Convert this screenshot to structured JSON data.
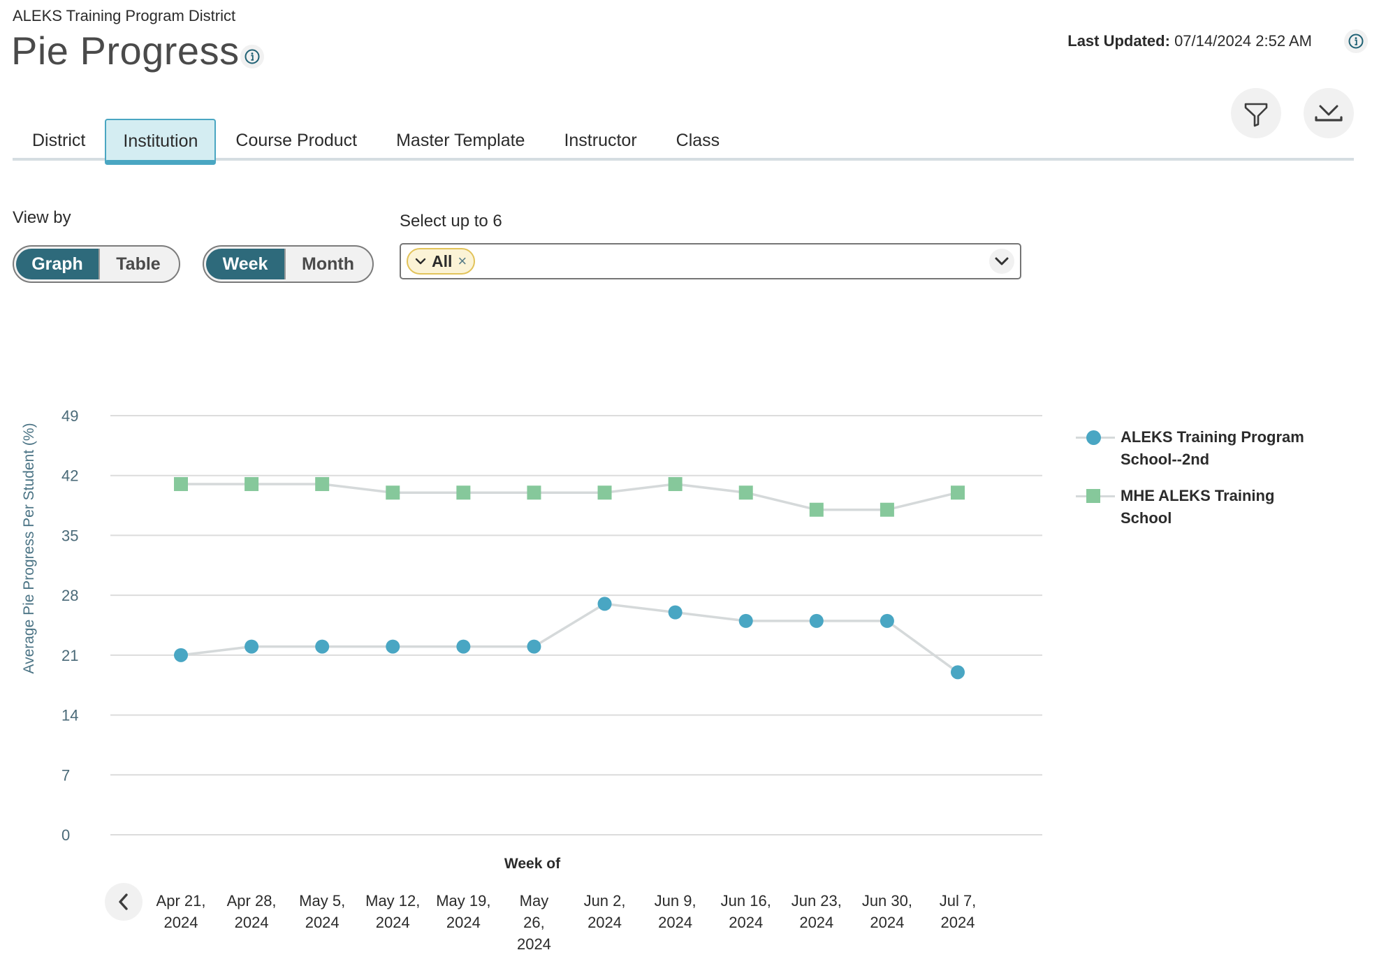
{
  "header": {
    "breadcrumb": "ALEKS Training Program District",
    "title": "Pie Progress",
    "title_info_icon": "info-icon",
    "last_updated_label": "Last Updated:",
    "last_updated_value": "07/14/2024 2:52 AM",
    "last_updated_info_icon": "info-icon",
    "filter_icon": "filter-icon",
    "download_icon": "download-icon"
  },
  "tabs": [
    {
      "label": "District",
      "active": false
    },
    {
      "label": "Institution",
      "active": true
    },
    {
      "label": "Course Product",
      "active": false
    },
    {
      "label": "Master Template",
      "active": false
    },
    {
      "label": "Instructor",
      "active": false
    },
    {
      "label": "Class",
      "active": false
    }
  ],
  "controls": {
    "view_by_label": "View by",
    "view_options": [
      {
        "label": "Graph",
        "selected": true
      },
      {
        "label": "Table",
        "selected": false
      }
    ],
    "period_options": [
      {
        "label": "Week",
        "selected": true
      },
      {
        "label": "Month",
        "selected": false
      }
    ],
    "select_label": "Select up to 6",
    "selected_chip": "All",
    "chip_remove": "×"
  },
  "colors": {
    "accent_teal": "#2e6a7b",
    "tab_active_bg": "#d4edf2",
    "tab_active_border": "#4aa6c2",
    "series_blue": "#49a6c3",
    "series_green": "#86c89b",
    "chip_bg": "#fbf3d6",
    "chip_border": "#e2c35a"
  },
  "chart_data": {
    "type": "line",
    "title": "",
    "xlabel": "Week of",
    "ylabel": "Average Pie Progress Per Student (%)",
    "ylim": [
      0,
      49
    ],
    "yticks": [
      0,
      7,
      14,
      21,
      28,
      35,
      42,
      49
    ],
    "grid": true,
    "legend_position": "right",
    "categories": [
      [
        "Apr 21,",
        "2024"
      ],
      [
        "Apr 28,",
        "2024"
      ],
      [
        "May 5,",
        "2024"
      ],
      [
        "May 12,",
        "2024"
      ],
      [
        "May 19,",
        "2024"
      ],
      [
        "May",
        "26,",
        "2024"
      ],
      [
        "Jun 2,",
        "2024"
      ],
      [
        "Jun 9,",
        "2024"
      ],
      [
        "Jun 16,",
        "2024"
      ],
      [
        "Jun 23,",
        "2024"
      ],
      [
        "Jun 30,",
        "2024"
      ],
      [
        "Jul 7,",
        "2024"
      ]
    ],
    "series": [
      {
        "name": "ALEKS Training Program School--2nd",
        "legend_lines": [
          "ALEKS Training Program",
          "School--2nd"
        ],
        "marker": "circle",
        "color": "#49a6c3",
        "values": [
          21,
          22,
          22,
          22,
          22,
          22,
          27,
          26,
          25,
          25,
          25,
          19
        ]
      },
      {
        "name": "MHE ALEKS Training School",
        "legend_lines": [
          "MHE ALEKS Training",
          "School"
        ],
        "marker": "square",
        "color": "#86c89b",
        "values": [
          41,
          41,
          41,
          40,
          40,
          40,
          40,
          41,
          40,
          38,
          38,
          40
        ]
      }
    ],
    "line_color": "#d5d9da",
    "prev_button_icon": "chevron-left-icon"
  }
}
